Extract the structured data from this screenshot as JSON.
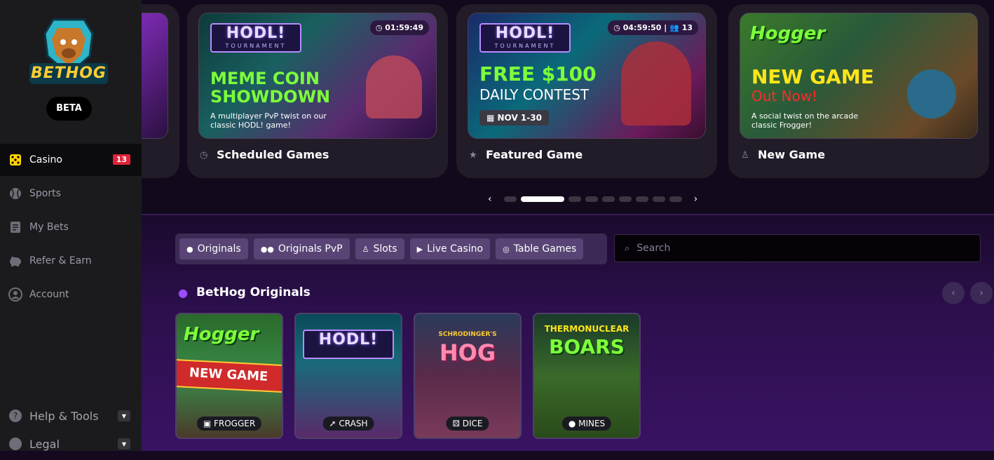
{
  "brand": {
    "name": "BETHOG",
    "beta": "BETA"
  },
  "sidebar": {
    "items": [
      {
        "label": "Casino",
        "icon": "dice-icon",
        "badge": "13"
      },
      {
        "label": "Sports",
        "icon": "baseball-icon"
      },
      {
        "label": "My Bets",
        "icon": "document-icon"
      },
      {
        "label": "Refer & Earn",
        "icon": "piggy-bank-icon"
      },
      {
        "label": "Account",
        "icon": "user-circle-icon"
      }
    ],
    "footer": [
      {
        "label": "Help & Tools",
        "icon": "help-icon"
      },
      {
        "label": "Legal",
        "icon": "legal-icon"
      }
    ]
  },
  "carousel": {
    "cards": [
      {
        "footer": "Scheduled Games",
        "icon": "clock-icon",
        "timer": "01:59:49",
        "logo_title": "HODL!",
        "logo_sub": "TOURNAMENT",
        "headline1": "MEME COIN",
        "headline2": "SHOWDOWN",
        "sub": "A multiplayer PvP twist on our classic HODL! game!"
      },
      {
        "footer": "Featured Game",
        "icon": "star-icon",
        "timer": "04:59:50",
        "players": "13",
        "logo_title": "HODL!",
        "logo_sub": "TOURNAMENT",
        "headline1": "FREE $100",
        "headline2": "DAILY CONTEST",
        "date": "NOV 1-30"
      },
      {
        "footer": "New Game",
        "icon": "joystick-icon",
        "logo_title": "Hogger",
        "headline1": "NEW GAME",
        "headline2": "Out Now!",
        "sub": "A social twist on the arcade classic Frogger!"
      }
    ],
    "pager": {
      "total": 9,
      "active": 1
    }
  },
  "filters": {
    "tabs": [
      {
        "label": "Originals",
        "icon": "user-icon"
      },
      {
        "label": "Originals PvP",
        "icon": "users-icon"
      },
      {
        "label": "Slots",
        "icon": "joystick-icon"
      },
      {
        "label": "Live Casino",
        "icon": "play-icon"
      },
      {
        "label": "Table Games",
        "icon": "chip-icon"
      }
    ],
    "search_placeholder": "Search"
  },
  "section": {
    "title": "BetHog Originals",
    "games": [
      {
        "label": "FROGGER",
        "title": "Hogger",
        "badge": "NEW GAME"
      },
      {
        "label": "CRASH",
        "title": "HODL!"
      },
      {
        "label": "DICE",
        "title": "HOG",
        "subtitle": "SCHRODINGER'S"
      },
      {
        "label": "MINES",
        "title": "BOARS",
        "subtitle": "THERMONUCLEAR"
      }
    ]
  }
}
